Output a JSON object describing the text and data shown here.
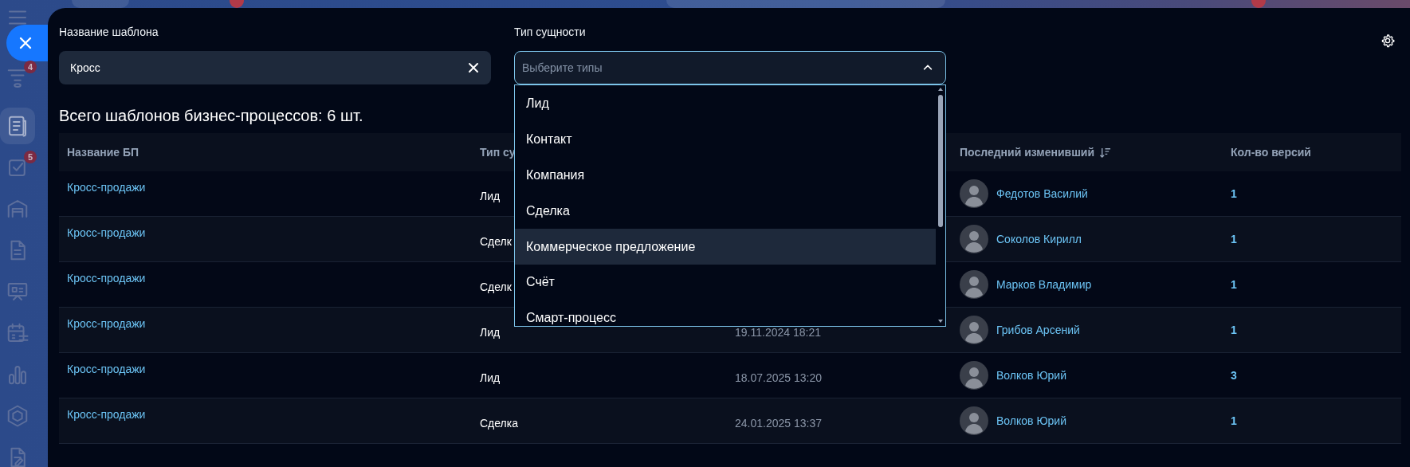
{
  "sidebar": {
    "items": [
      {
        "selected": false
      },
      {
        "badge": "4",
        "selected": false
      },
      {
        "selected": true
      },
      {
        "badge": "5",
        "selected": false
      },
      {
        "selected": false
      },
      {
        "selected": false
      },
      {
        "selected": false
      },
      {
        "selected": false
      },
      {
        "selected": false
      },
      {
        "selected": false
      },
      {
        "selected": false
      }
    ]
  },
  "filters": {
    "template_name": {
      "label": "Название шаблона",
      "value": "Кросс"
    },
    "entity_type": {
      "label": "Тип сущности",
      "placeholder": "Выберите типы",
      "expanded": true,
      "options": [
        {
          "label": "Лид",
          "highlighted": false
        },
        {
          "label": "Контакт",
          "highlighted": false
        },
        {
          "label": "Компания",
          "highlighted": false
        },
        {
          "label": "Сделка",
          "highlighted": false
        },
        {
          "label": "Коммерческое предложение",
          "highlighted": true
        },
        {
          "label": "Счёт",
          "highlighted": false
        },
        {
          "label": "Смарт-процесс",
          "highlighted": false
        }
      ]
    }
  },
  "summary": "Всего шаблонов бизнес-процессов: 6 шт.",
  "table": {
    "header": {
      "name": "Название БП",
      "type": "Тип су",
      "editor": "Последний изменивший",
      "editor_sorted": true,
      "versions": "Кол-во версий"
    },
    "rows": [
      {
        "name": "Кросс-продажи",
        "type": "Лид",
        "editor": "Федотов Василий",
        "versions": "1"
      },
      {
        "name": "Кросс-продажи",
        "type": "Сделк",
        "editor": "Соколов Кирилл",
        "versions": "1"
      },
      {
        "name": "Кросс-продажи",
        "type": "Сделк",
        "editor": "Марков Владимир",
        "versions": "1"
      },
      {
        "name": "Кросс-продажи",
        "type": "Лид",
        "date": "19.11.2024 18:21",
        "editor": "Грибов Арсений",
        "versions": "1"
      },
      {
        "name": "Кросс-продажи",
        "type": "Лид",
        "date": "18.07.2025 13:20",
        "editor": "Волков Юрий",
        "versions": "3"
      },
      {
        "name": "Кросс-продажи",
        "type": "Сделка",
        "date": "24.01.2025 13:37",
        "editor": "Волков Юрий",
        "versions": "1"
      }
    ]
  }
}
